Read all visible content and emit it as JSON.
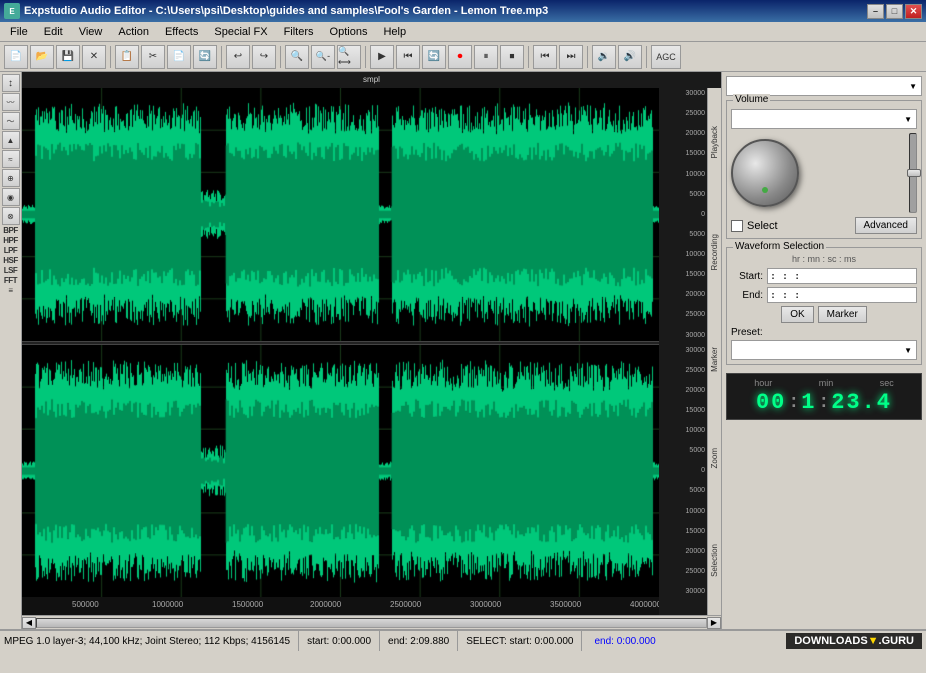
{
  "titlebar": {
    "title": "Expstudio Audio Editor - C:\\Users\\psi\\Desktop\\guides and samples\\Fool's Garden - Lemon Tree.mp3",
    "min_label": "–",
    "max_label": "□",
    "close_label": "✕"
  },
  "menu": {
    "items": [
      "File",
      "Edit",
      "View",
      "Action",
      "Effects",
      "Special FX",
      "Filters",
      "Options",
      "Help"
    ]
  },
  "toolbar": {
    "buttons": [
      "📄",
      "📂",
      "💾",
      "✕",
      "📋",
      "✂",
      "📄",
      "🔄",
      "↩",
      "↪",
      "🔍+",
      "🔍-",
      "🔍",
      "▶",
      "⏮",
      "🔄",
      "⏺",
      "⏸",
      "⏹",
      "◀◀",
      "▶▶",
      "🔊",
      "🔉",
      "AGC"
    ]
  },
  "left_toolbar": {
    "items": [
      "↕",
      "〰",
      "〜",
      "▲",
      "≈",
      "⊕",
      "◉",
      "⊗",
      "BPF",
      "HPF",
      "LPF",
      "HSF",
      "LSF",
      "FFT",
      "≡"
    ]
  },
  "scale": {
    "header": "smpl",
    "top_values": [
      "30000",
      "25000",
      "20000",
      "15000",
      "10000",
      "5000",
      "0",
      "5000",
      "10000",
      "15000",
      "20000",
      "25000",
      "30000"
    ],
    "bottom_values": [
      "30000",
      "25000",
      "20000",
      "15000",
      "10000",
      "5000",
      "0",
      "5000",
      "10000",
      "15000",
      "20000",
      "25000",
      "30000"
    ]
  },
  "time_ruler": {
    "labels": [
      "500000",
      "1000000",
      "1500000",
      "2000000",
      "2500000",
      "3000000",
      "3500000",
      "4000000"
    ]
  },
  "right_panel": {
    "device_dropdown": "",
    "volume_label": "Volume",
    "volume_dropdown": "",
    "advanced_label": "Advanced",
    "select_label": "Select",
    "playback_label": "Playback",
    "recording_label": "Recording",
    "waveform_selection_label": "Waveform Selection",
    "hr_mn_sc_ms": "hr : mn : sc : ms",
    "start_label": "Start:",
    "start_value": ": : :",
    "end_label": "End:",
    "end_value": ": : :",
    "ok_label": "OK",
    "marker_label": "Marker",
    "preset_label": "Preset:",
    "preset_value": ""
  },
  "clock": {
    "hour_label": "hour",
    "min_label": "min",
    "sec_label": "sec",
    "hour_value": "00",
    "colon1": ":",
    "min_value": "1",
    "colon2": ":",
    "sec_value": "23.4"
  },
  "status_bar": {
    "format": "MPEG 1.0 layer-3; 44,100 kHz; Joint Stereo; 112 Kbps; 4156145",
    "start": "start: 0:00.000",
    "end": "end: 2:09.880",
    "select": "SELECT: start: 0:00.000",
    "select_end": "end: 0:00.000"
  },
  "watermark": {
    "text": "DOWNLOADS▼.GURU"
  },
  "vertical_labels": {
    "items": [
      "Selection",
      "Zoom",
      "Marker"
    ]
  }
}
